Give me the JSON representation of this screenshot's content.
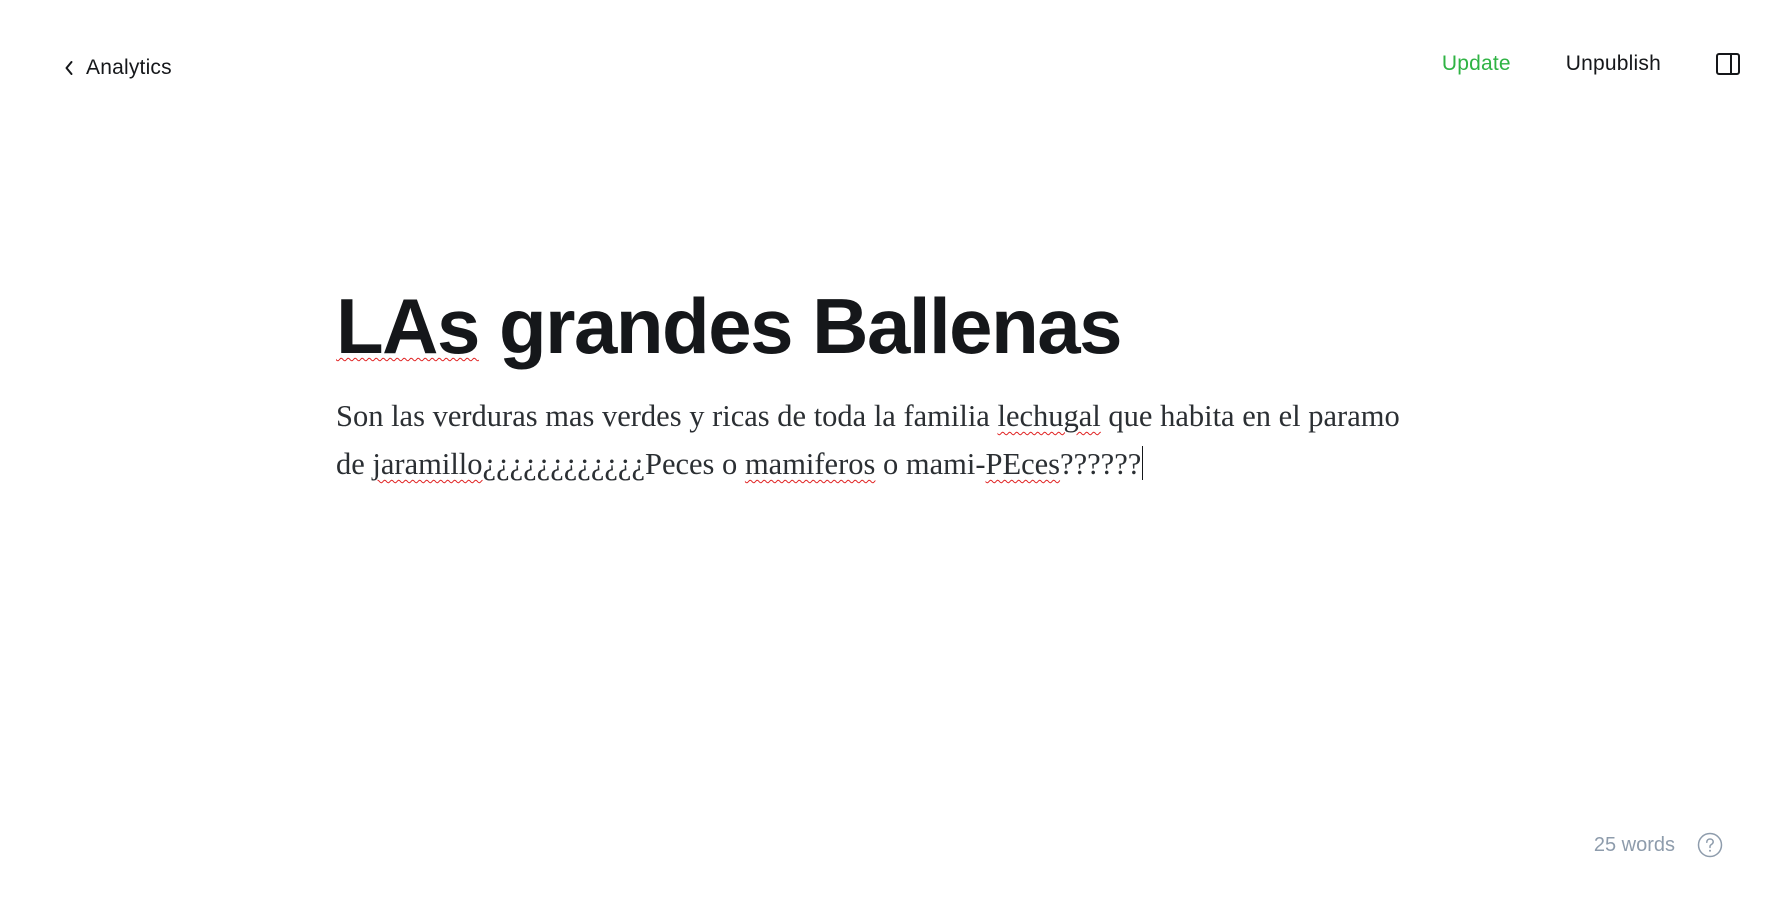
{
  "header": {
    "back_label": "Analytics",
    "update_label": "Update",
    "unpublish_label": "Unpublish"
  },
  "post": {
    "title_word_1": "LAs",
    "title_rest": " grandes Ballenas",
    "body": {
      "seg_1": "Son las verduras mas verdes y ricas de toda la familia ",
      "seg_2": "lechugal",
      "seg_3": " que habita en el paramo de ",
      "seg_4": "jaramillo",
      "seg_5": "¿¿¿¿¿¿¿¿¿¿¿¿Peces o ",
      "seg_6": "mamiferos",
      "seg_7": " o mami-",
      "seg_8": "PEces",
      "seg_9": "??????"
    }
  },
  "footer": {
    "word_count": "25 words"
  },
  "icons": {
    "back": "chevron-left-icon",
    "panel": "sidebar-panel-icon",
    "help": "help-circle-icon"
  },
  "colors": {
    "accent_green": "#2fb344",
    "text_dark": "#15171a",
    "muted": "#8e9cac",
    "spellcheck_red": "#e02020"
  }
}
